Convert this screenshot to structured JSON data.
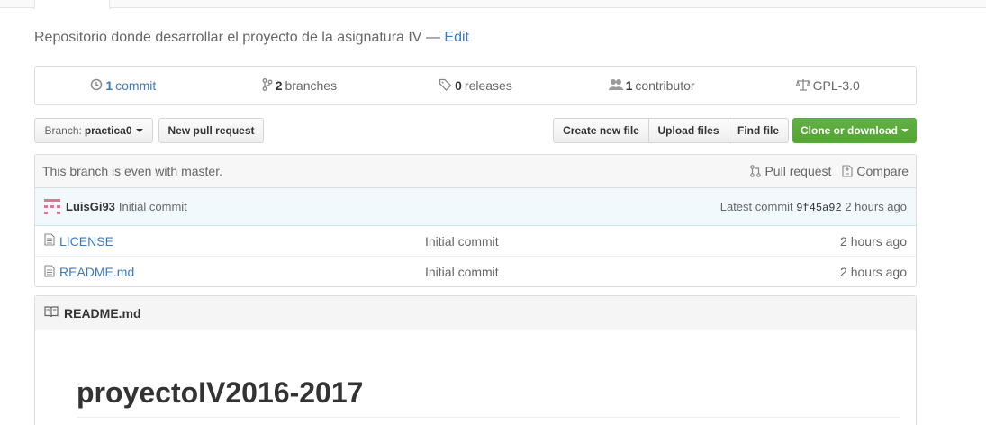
{
  "repo": {
    "description": "Repositorio donde desarrollar el proyecto de la asignatura IV",
    "separator": "—",
    "edit_label": "Edit"
  },
  "summary": {
    "commits_count": "1",
    "commits_label": "commit",
    "branches_count": "2",
    "branches_label": "branches",
    "releases_count": "0",
    "releases_label": "releases",
    "contributors_count": "1",
    "contributors_label": "contributor",
    "license": "GPL-3.0"
  },
  "toolbar": {
    "branch_prefix": "Branch:",
    "branch_name": "practica0",
    "new_pull_request": "New pull request",
    "create_new_file": "Create new file",
    "upload_files": "Upload files",
    "find_file": "Find file",
    "clone_or_download": "Clone or download"
  },
  "branch_status": {
    "message": "This branch is even with master.",
    "pull_request": "Pull request",
    "compare": "Compare"
  },
  "latest_commit": {
    "author": "LuisGi93",
    "message": "Initial commit",
    "prefix": "Latest commit",
    "sha": "9f45a92",
    "age": "2 hours ago"
  },
  "files": [
    {
      "name": "LICENSE",
      "message": "Initial commit",
      "age": "2 hours ago"
    },
    {
      "name": "README.md",
      "message": "Initial commit",
      "age": "2 hours ago"
    }
  ],
  "readme": {
    "filename": "README.md",
    "heading": "proyectoIV2016-2017"
  },
  "colors": {
    "link": "#4078c0",
    "clone_button": "#55a532",
    "commit_bar": "#f2f9fc",
    "avatar": "#e0758d"
  },
  "icons": {
    "commits": "history-icon",
    "branches": "git-branch-icon",
    "releases": "tag-icon",
    "contributors": "organization-icon",
    "license": "law-icon",
    "pull_request": "git-pull-request-icon",
    "compare": "diff-icon",
    "file": "file-text-icon",
    "readme": "book-icon"
  }
}
